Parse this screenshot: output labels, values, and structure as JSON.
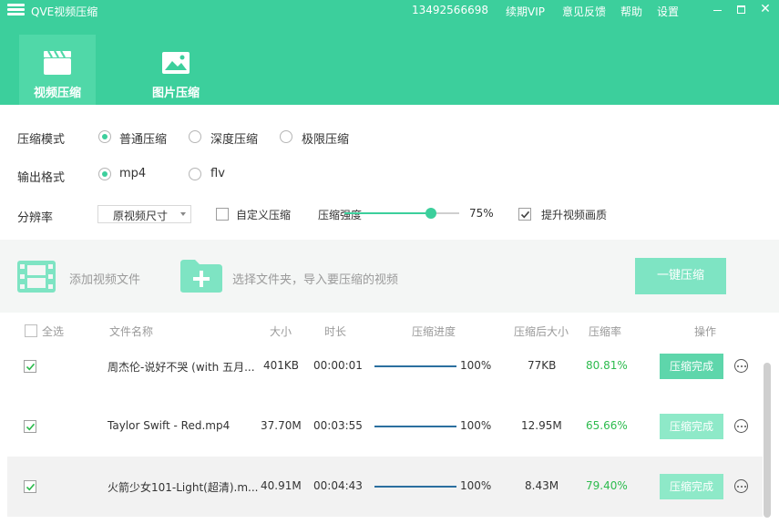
{
  "titlebar": {
    "app_title": "QVE视频压缩",
    "phone": "13492566698",
    "menu": [
      "续期VIP",
      "意见反馈",
      "帮助",
      "设置"
    ],
    "close_glyph": "✕"
  },
  "tabs": [
    {
      "label": "视频压缩",
      "icon": "clapperboard-icon",
      "active": true
    },
    {
      "label": "图片压缩",
      "icon": "image-icon",
      "active": false
    }
  ],
  "settings": {
    "mode": {
      "label": "压缩模式",
      "options": [
        "普通压缩",
        "深度压缩",
        "极限压缩"
      ],
      "selected": "普通压缩"
    },
    "format": {
      "label": "输出格式",
      "options": [
        "mp4",
        "flv"
      ],
      "selected": "mp4"
    },
    "resolution": {
      "label": "分辨率",
      "select_value": "原视频尺寸",
      "custom_label": "自定义压缩",
      "custom_checked": false,
      "strength_label": "压缩强度",
      "strength_value": 0.75,
      "strength_text": "75%",
      "enhance_label": "提升视频画质",
      "enhance_checked": true
    }
  },
  "actions": {
    "add_file": "添加视频文件",
    "select_folder": "选择文件夹，导入要压缩的视频",
    "compress_all": "一键压缩"
  },
  "table": {
    "headers": {
      "select_all": "全选",
      "name": "文件名称",
      "size": "大小",
      "duration": "时长",
      "progress": "压缩进度",
      "new_size": "压缩后大小",
      "rate": "压缩率",
      "ops": "操作"
    },
    "rows": [
      {
        "checked": true,
        "name": "周杰伦-说好不哭 (with 五月...",
        "size": "401KB",
        "duration": "00:00:01",
        "progress": "100%",
        "new_size": "77KB",
        "rate": "80.81%",
        "status": "压缩完成"
      },
      {
        "checked": true,
        "name": "Taylor Swift - Red.mp4",
        "size": "37.70M",
        "duration": "00:03:55",
        "progress": "100%",
        "new_size": "12.95M",
        "rate": "65.66%",
        "status": "压缩完成"
      },
      {
        "checked": true,
        "name": "火箭少女101-Light(超清).m...",
        "size": "40.91M",
        "duration": "00:04:43",
        "progress": "100%",
        "new_size": "8.43M",
        "rate": "79.40%",
        "status": "压缩完成"
      }
    ]
  },
  "colors": {
    "brand": "#3ccf9c",
    "active_tab": "#50d8a8",
    "rate": "#2dbb4e",
    "progress_bar": "#2b6f9f"
  }
}
